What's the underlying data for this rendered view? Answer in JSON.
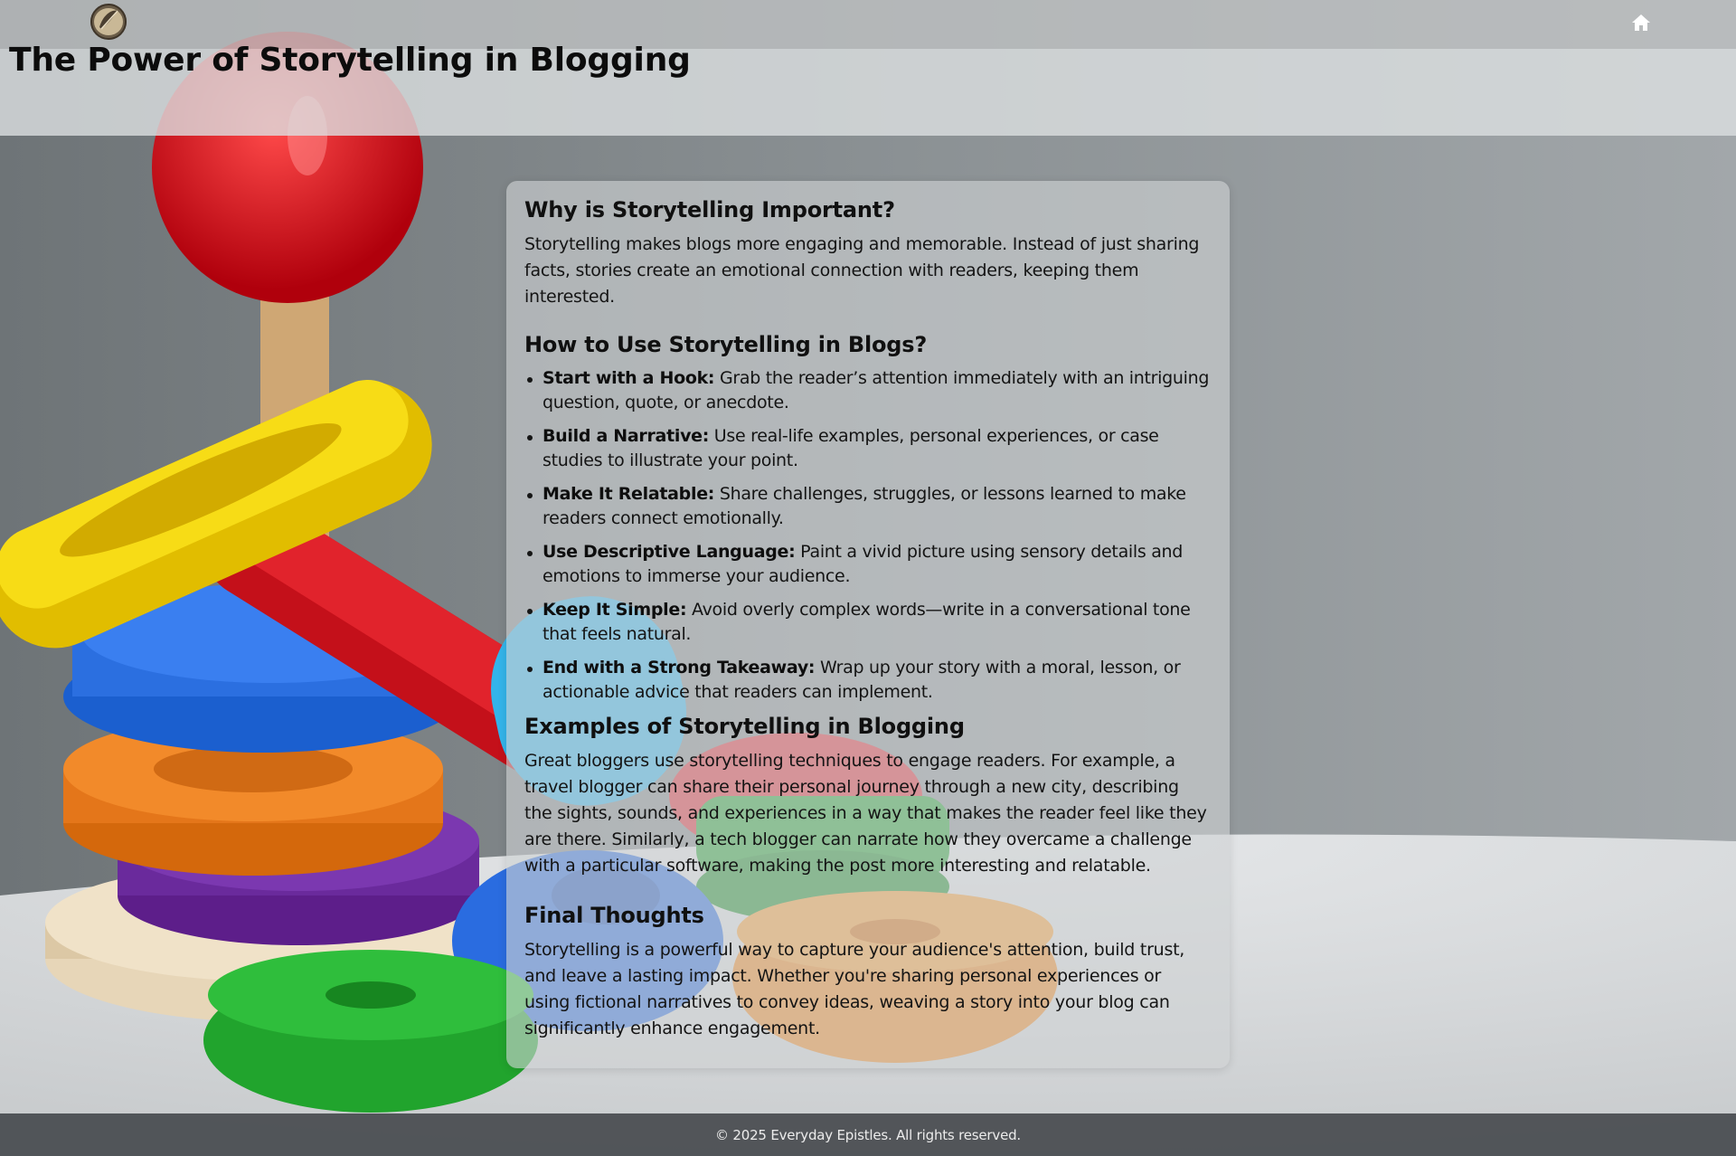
{
  "header": {
    "title": "The Power of Storytelling in Blogging",
    "logo_icon": "feather-emblem-icon",
    "home_icon": "home-icon"
  },
  "article": {
    "sections": [
      {
        "heading": "Why is Storytelling Important?",
        "text": "Storytelling makes blogs more engaging and memorable. Instead of just sharing facts, stories create an emotional connection with readers, keeping them interested."
      },
      {
        "heading": "How to Use Storytelling in Blogs?",
        "items": [
          {
            "label": "Start with a Hook:",
            "text": "Grab the reader’s attention immediately with an intriguing question, quote, or anecdote."
          },
          {
            "label": "Build a Narrative:",
            "text": "Use real-life examples, personal experiences, or case studies to illustrate your point."
          },
          {
            "label": "Make It Relatable:",
            "text": "Share challenges, struggles, or lessons learned to make readers connect emotionally."
          },
          {
            "label": "Use Descriptive Language:",
            "text": "Paint a vivid picture using sensory details and emotions to immerse your audience."
          },
          {
            "label": "Keep It Simple:",
            "text": "Avoid overly complex words—write in a conversational tone that feels natural."
          },
          {
            "label": "End with a Strong Takeaway:",
            "text": "Wrap up your story with a moral, lesson, or actionable advice that readers can implement."
          }
        ]
      },
      {
        "heading": "Examples of Storytelling in Blogging",
        "text": "Great bloggers use storytelling techniques to engage readers. For example, a travel blogger can share their personal journey through a new city, describing the sights, sounds, and experiences in a way that makes the reader feel like they are there. Similarly, a tech blogger can narrate how they overcame a challenge with a particular software, making the post more interesting and relatable."
      },
      {
        "heading": "Final Thoughts",
        "text": "Storytelling is a powerful way to capture your audience's attention, build trust, and leave a lasting impact. Whether you're sharing personal experiences or using fictional narratives to convey ideas, weaving a story into your blog can significantly enhance engagement."
      }
    ]
  },
  "footer": {
    "copyright": "© 2025 Everyday Epistles. All rights reserved."
  },
  "colors": {
    "header_bar": "#bec1c2",
    "title_bar": "#dce0e1",
    "card": "#ced2d4",
    "footer": "#4b4e52",
    "background_wall": "#7e8487"
  }
}
